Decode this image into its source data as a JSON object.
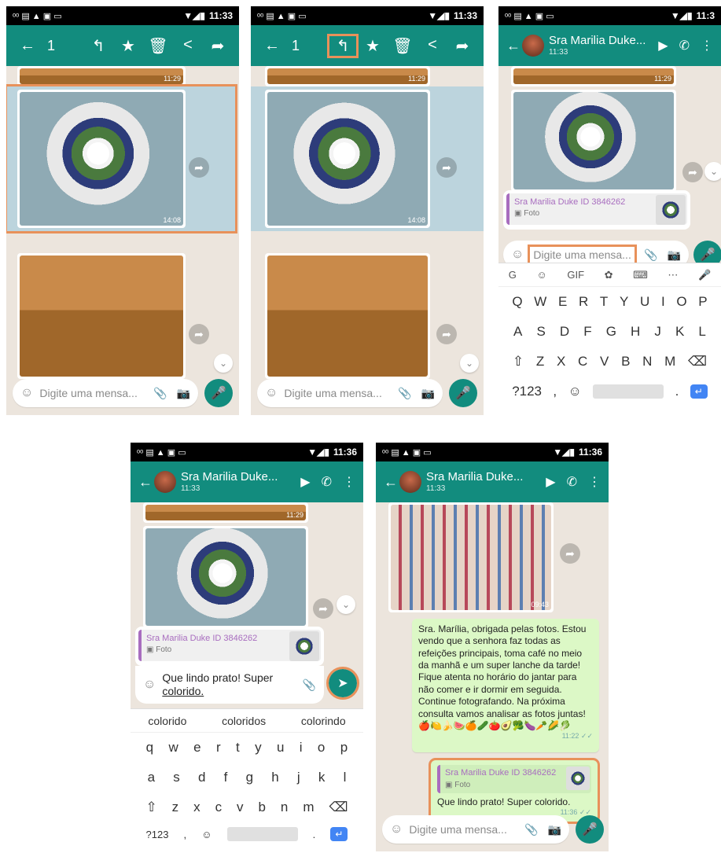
{
  "status": {
    "icons": "ᵒᵒ ▤ ▲ ▣ ▭",
    "time1": "11:33",
    "time2": "11:33",
    "time3": "11:3",
    "time4": "11:36",
    "time5": "11:36"
  },
  "select_bar": {
    "back": "←",
    "count": "1",
    "reply": "↰",
    "star": "★",
    "delete": "🗑",
    "share": "<",
    "forward": "➦"
  },
  "contact": {
    "name": "Sra Marilia Duke...",
    "time": "11:33"
  },
  "messages": {
    "ts_top": "11:29",
    "ts_photo1": "14:08",
    "ts_photo3": "09:43"
  },
  "input": {
    "placeholder": "Digite uma mensa..."
  },
  "reply": {
    "name": "Sra Marilia Duke ID 3846262",
    "type": "Foto"
  },
  "typed": {
    "line1": "Que lindo prato! Super",
    "line2": "colorido."
  },
  "keyboard": {
    "tools": [
      "G",
      "☺",
      "GIF",
      "✿",
      "⌨",
      "⋯",
      "🎤"
    ],
    "row1_upper": [
      "Q",
      "W",
      "E",
      "R",
      "T",
      "Y",
      "U",
      "I",
      "O",
      "P"
    ],
    "row2_upper": [
      "A",
      "S",
      "D",
      "F",
      "G",
      "H",
      "J",
      "K",
      "L"
    ],
    "row3_upper": [
      "⇧",
      "Z",
      "X",
      "C",
      "V",
      "B",
      "N",
      "M",
      "⌫"
    ],
    "row1_lower": [
      "q",
      "w",
      "e",
      "r",
      "t",
      "y",
      "u",
      "i",
      "o",
      "p"
    ],
    "row2_lower": [
      "a",
      "s",
      "d",
      "f",
      "g",
      "h",
      "j",
      "k",
      "l"
    ],
    "row3_lower": [
      "⇧",
      "z",
      "x",
      "c",
      "v",
      "b",
      "n",
      "m",
      "⌫"
    ],
    "bottom_left": "?123",
    "suggestions": [
      "colorido",
      "coloridos",
      "colorindo"
    ]
  },
  "bubble_text": "Sra. Marília, obrigada pelas fotos. Estou vendo que a senhora faz todas as refeições principais, toma café no meio da manhã e um super lanche da tarde! Fique atenta no horário do jantar para não comer e ir dormir em seguida. Continue fotografando. Na próxima consulta vamos analisar as fotos juntas!🍎🍋🍌🍉🍊🥒🍅🥑🥦🍆🥕🌽🥬",
  "bubble_time": "11:22 ✓✓",
  "reply_msg": {
    "text": "Que lindo prato! Super colorido.",
    "time": "11:36 ✓✓"
  }
}
